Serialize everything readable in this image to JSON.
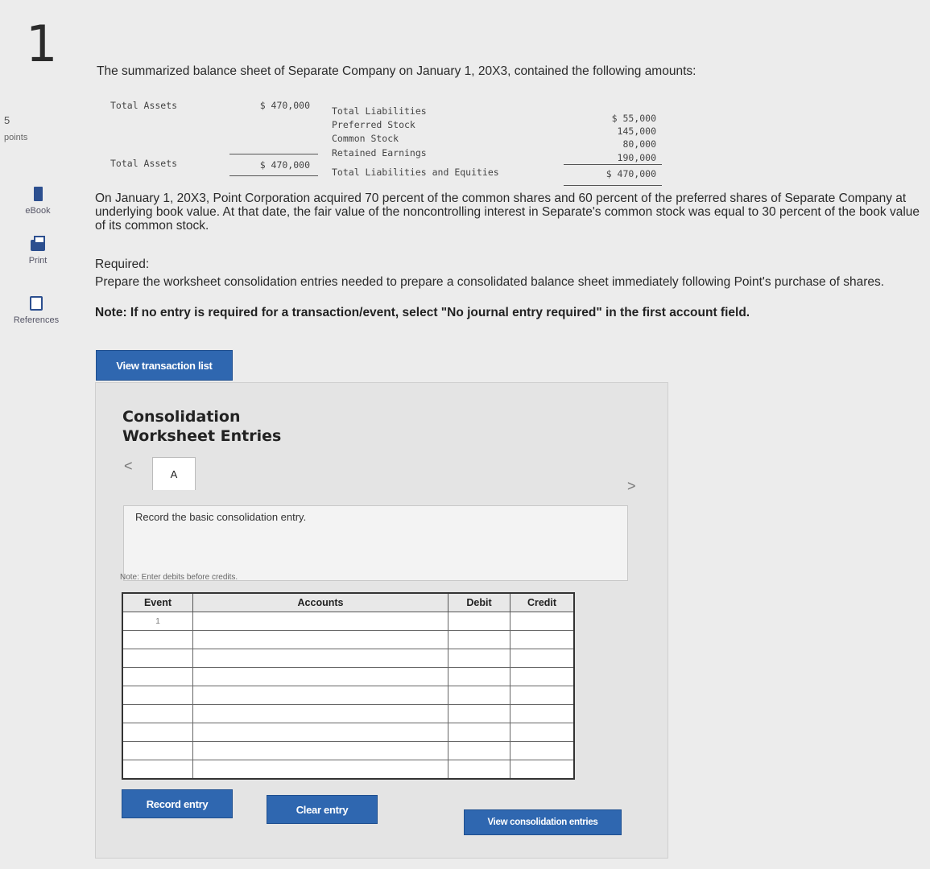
{
  "question": {
    "number": "1",
    "points_value": "5",
    "points_label": "points",
    "intro": "The summarized balance sheet of Separate Company on January 1, 20X3, contained the following amounts:"
  },
  "sidebar": {
    "ebook": "eBook",
    "print": "Print",
    "references": "References"
  },
  "balance_sheet": {
    "left_top_label": "Total Assets",
    "left_top_amount": "$ 470,000",
    "left_bottom_label": "Total Assets",
    "left_bottom_amount": "$ 470,000",
    "right": [
      {
        "label": "Total Liabilities",
        "amount": "$ 55,000"
      },
      {
        "label": "Preferred Stock",
        "amount": "145,000"
      },
      {
        "label": "Common Stock",
        "amount": "80,000"
      },
      {
        "label": "Retained Earnings",
        "amount": "190,000"
      },
      {
        "label": "Total Liabilities and Equities",
        "amount": "$ 470,000"
      }
    ]
  },
  "body": {
    "paragraph": "On January 1, 20X3, Point Corporation acquired 70 percent of the common shares and 60 percent of the preferred shares of Separate Company at underlying book value. At that date, the fair value of the noncontrolling interest in Separate's common stock was equal to 30 percent of the book value of its common stock.",
    "required_label": "Required:",
    "required_text": "Prepare the worksheet consolidation entries needed to prepare a consolidated balance sheet immediately following Point's purchase of shares.",
    "note": "Note: If no entry is required for a transaction/event, select \"No journal entry required\" in the first account field."
  },
  "buttons": {
    "view_transaction_list": "View transaction list",
    "record_entry": "Record entry",
    "clear_entry": "Clear entry",
    "view_consolidation_entries": "View consolidation entries"
  },
  "worksheet": {
    "title_line1": "Consolidation",
    "title_line2": "Worksheet Entries",
    "nav_prev": "<",
    "nav_next": ">",
    "tab_label": "A",
    "instruction": "Record the basic consolidation entry.",
    "note": "Note: Enter debits before credits.",
    "headers": [
      "Event",
      "Accounts",
      "Debit",
      "Credit"
    ],
    "first_event": "1"
  }
}
